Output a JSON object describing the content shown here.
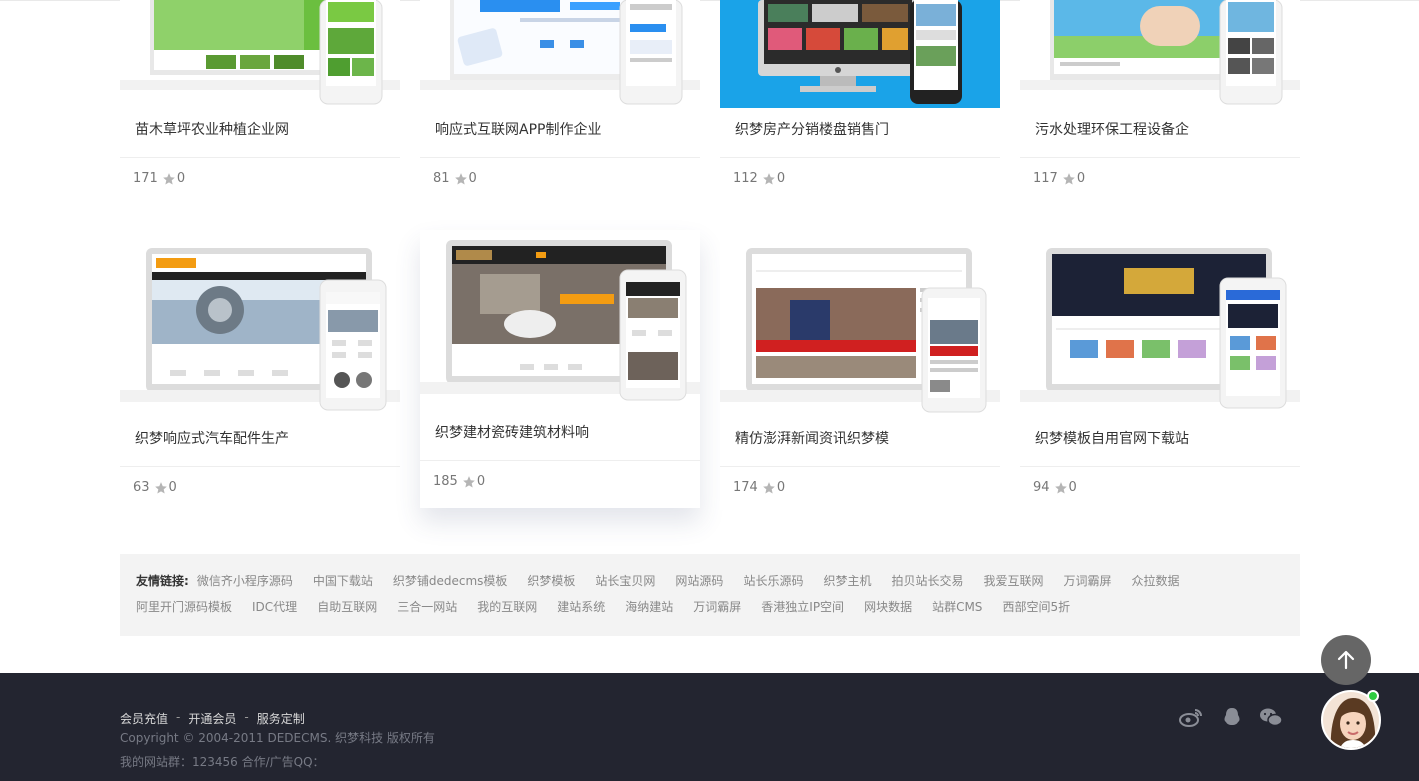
{
  "cards": [
    {
      "title": "苗木草坪农业种植企业网",
      "views": "171",
      "likes": "0",
      "theme": "green"
    },
    {
      "title": "响应式互联网APP制作企业",
      "views": "81",
      "likes": "0",
      "theme": "app"
    },
    {
      "title": "织梦房产分销楼盘销售门",
      "views": "112",
      "likes": "0",
      "theme": "blue"
    },
    {
      "title": "污水处理环保工程设备企",
      "views": "117",
      "likes": "0",
      "theme": "sky"
    },
    {
      "title": "织梦响应式汽车配件生产",
      "views": "63",
      "likes": "0",
      "theme": "auto"
    },
    {
      "title": "织梦建材瓷砖建筑材料响",
      "views": "185",
      "likes": "0",
      "theme": "tile"
    },
    {
      "title": "精仿澎湃新闻资讯织梦模",
      "views": "174",
      "likes": "0",
      "theme": "news"
    },
    {
      "title": "织梦模板自用官网下载站",
      "views": "94",
      "likes": "0",
      "theme": "vip"
    }
  ],
  "friend_links": {
    "label": "友情链接:",
    "items": [
      "微信齐小程序源码",
      "中国下载站",
      "织梦铺dedecms模板",
      "织梦模板",
      "站长宝贝网",
      "网站源码",
      "站长乐源码",
      "织梦主机",
      "拍贝站长交易",
      "我爱互联网",
      "万词霸屏",
      "众拉数据",
      "阿里开门源码模板",
      "IDC代理",
      "自助互联网",
      "三合一网站",
      "我的互联网",
      "建站系统",
      "海纳建站",
      "万词霸屏",
      "香港独立IP空间",
      "网块数据",
      "站群CMS",
      "西部空间5折"
    ]
  },
  "footer": {
    "nav": [
      "会员充值",
      "开通会员",
      "服务定制"
    ],
    "nav_sep": "-",
    "copyright": "Copyright © 2004-2011 DEDECMS. 织梦科技 版权所有",
    "site_group": "我的网站群：123456 合作/广告QQ："
  },
  "icons": {
    "back_to_top": "arrow-up-icon",
    "star": "star-icon",
    "weibo": "weibo-icon",
    "qq": "qq-icon",
    "wechat": "wechat-icon",
    "avatar": "customer-service-avatar"
  },
  "colors": {
    "footer_bg": "#232530",
    "link_bar_bg": "#f3f3f3",
    "online": "#2ecc40",
    "star": "#b5b5b5"
  }
}
